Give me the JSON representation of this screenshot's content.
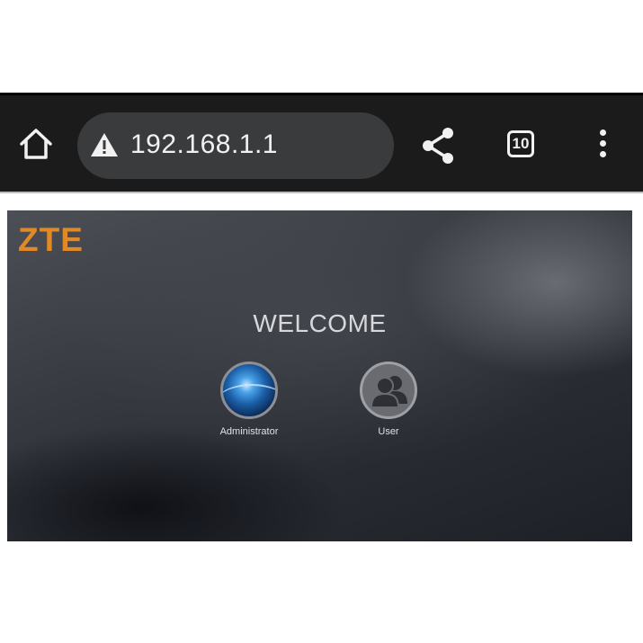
{
  "browser": {
    "url": "192.168.1.1",
    "tab_count": "10",
    "icons": [
      "home-icon",
      "warning-icon",
      "share-icon",
      "tabs-icon",
      "more-vert-icon"
    ]
  },
  "router": {
    "brand": "ZTE",
    "brand_color": "#e08a27",
    "welcome": "WELCOME",
    "accounts": [
      {
        "label": "Administrator",
        "icon": "admin-avatar-icon"
      },
      {
        "label": "User",
        "icon": "user-group-icon"
      }
    ]
  }
}
